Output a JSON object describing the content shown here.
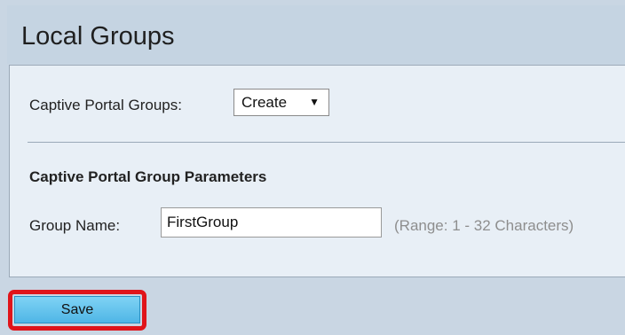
{
  "header": {
    "title": "Local Groups"
  },
  "form": {
    "captive_portal_groups_label": "Captive Portal Groups:",
    "captive_portal_groups_value": "Create",
    "select_arrow": "▼",
    "section_heading": "Captive Portal Group Parameters",
    "group_name_label": "Group Name:",
    "group_name_value": "FirstGroup",
    "group_name_hint": "(Range: 1 - 32 Characters)"
  },
  "actions": {
    "save_label": "Save"
  },
  "colors": {
    "page_background": "#c9d6e3",
    "panel_background": "#e8eff6",
    "save_button": "#5cc0ec",
    "highlight": "#e0141a"
  }
}
